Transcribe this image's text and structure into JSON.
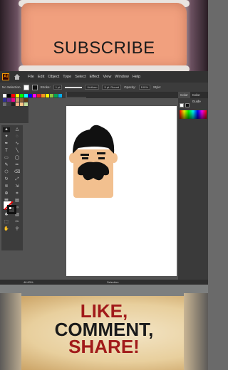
{
  "top_banner": {
    "text": "SUBSCRIBE"
  },
  "app": {
    "logo": "Ai",
    "menu": [
      "File",
      "Edit",
      "Object",
      "Type",
      "Select",
      "Effect",
      "View",
      "Window",
      "Help"
    ],
    "control_bar": {
      "selection": "No Selection",
      "stroke_label": "Stroke:",
      "stroke_value": "1 pt",
      "profile": "Uniform",
      "brush": "5 pt. Round",
      "opacity_label": "Opacity:",
      "opacity_value": "100%",
      "style_label": "Style:"
    },
    "doc_tab": "(Preview)",
    "panel_tabs": [
      "Color",
      "Color Guide"
    ],
    "status": {
      "zoom": "46.83%",
      "tool": "Selection"
    }
  },
  "bottom_banner": {
    "line1": "LIKE,",
    "line2": "COMMENT,",
    "line3": "SHARE!"
  },
  "colors": {
    "ui_dark": "#323232",
    "ui_mid": "#535353",
    "canvas": "#ffffff",
    "skin": "#f2c08f",
    "hair": "#111111",
    "accent_red": "#a11a1a"
  },
  "icons": [
    "selection-icon",
    "direct-selection-icon",
    "magic-wand-icon",
    "lasso-icon",
    "pen-icon",
    "curvature-icon",
    "type-icon",
    "line-icon",
    "rectangle-icon",
    "ellipse-icon",
    "paintbrush-icon",
    "pencil-icon",
    "shaper-icon",
    "eraser-icon",
    "rotate-icon",
    "scale-icon",
    "width-icon",
    "free-transform-icon",
    "shape-builder-icon",
    "perspective-icon",
    "mesh-icon",
    "gradient-icon",
    "eyedropper-icon",
    "blend-icon",
    "symbol-sprayer-icon",
    "graph-icon",
    "artboard-icon",
    "slice-icon",
    "hand-icon",
    "zoom-icon"
  ]
}
